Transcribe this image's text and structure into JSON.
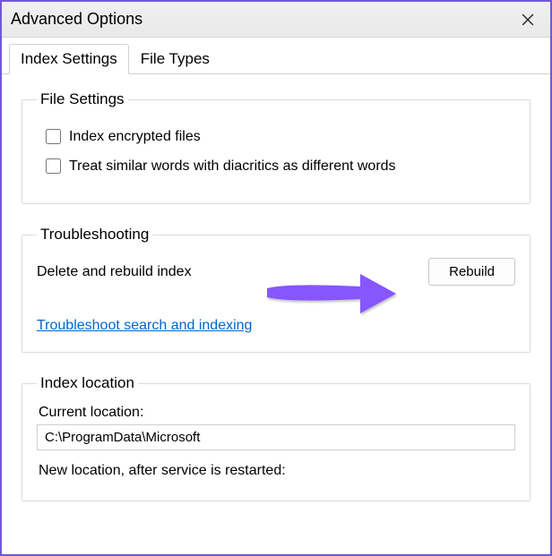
{
  "window": {
    "title": "Advanced Options"
  },
  "tabs": {
    "index_settings": "Index Settings",
    "file_types": "File Types"
  },
  "file_settings": {
    "legend": "File Settings",
    "encrypt": "Index encrypted files",
    "diacritics": "Treat similar words with diacritics as different words"
  },
  "troubleshooting": {
    "legend": "Troubleshooting",
    "delete_label": "Delete and rebuild index",
    "rebuild_button": "Rebuild",
    "link": "Troubleshoot search and indexing"
  },
  "index_location": {
    "legend": "Index location",
    "current_label": "Current location:",
    "current_value": "C:\\ProgramData\\Microsoft",
    "new_label": "New location, after service is restarted:"
  }
}
